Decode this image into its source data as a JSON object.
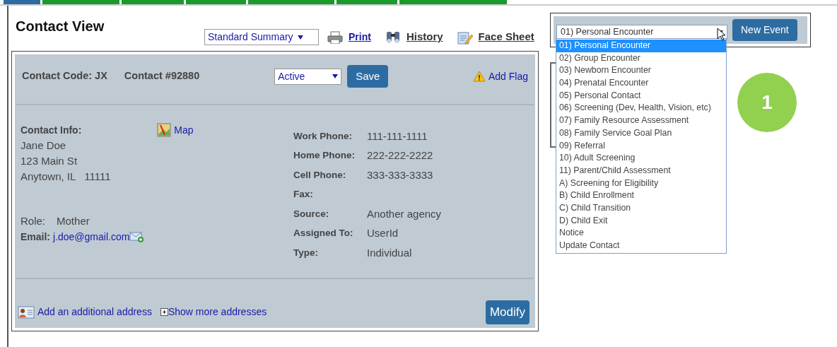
{
  "nav_tabs": [
    {
      "selected": true
    },
    {
      "selected": false
    },
    {
      "selected": false
    },
    {
      "selected": false
    },
    {
      "selected": false
    },
    {
      "selected": false
    },
    {
      "selected": false
    }
  ],
  "page_title": "Contact View",
  "summary_select": {
    "value": "Standard Summary"
  },
  "actions": [
    {
      "label": "Print",
      "kind": "print"
    },
    {
      "label": "History",
      "kind": "history"
    },
    {
      "label": "Face Sheet",
      "kind": "facesheet"
    }
  ],
  "contact": {
    "code_label": "Contact Code: JX",
    "number_label": "Contact #92880",
    "status_select": {
      "value": "Active"
    },
    "save_button": "Save",
    "add_flag": "Add Flag",
    "info_label": "Contact Info:",
    "map_link": "Map",
    "address_lines": [
      "Jane Doe",
      "123 Main St",
      "Anytown, IL   11111"
    ],
    "role_label": "Role:",
    "role": "Mother",
    "email_label": "Email:",
    "email": "j.doe@gmail.com",
    "fields": [
      {
        "label": "Work Phone:",
        "value": "111-111-1111"
      },
      {
        "label": "Home Phone:",
        "value": "222-222-2222"
      },
      {
        "label": "Cell Phone:",
        "value": "333-333-3333"
      },
      {
        "label": "Fax:"
      },
      {
        "label": "Source:",
        "value": "Another agency"
      },
      {
        "label": "Assigned To:",
        "value": "UserId"
      },
      {
        "label": "Type:",
        "value": "Individual"
      }
    ],
    "add_address": "Add an additional address",
    "show_more": "Show more addresses",
    "modify_button": "Modify"
  },
  "event": {
    "select_value": "01) Personal Encounter",
    "new_event_button": "New Event",
    "options": [
      {
        "label": "01) Personal Encounter",
        "selected": true
      },
      {
        "label": "02) Group Encounter",
        "selected": false
      },
      {
        "label": "03) Newborn Encounter",
        "selected": false
      },
      {
        "label": "04) Prenatal Encounter",
        "selected": false
      },
      {
        "label": "05) Personal Contact",
        "selected": false
      },
      {
        "label": "06) Screening (Dev, Health, Vision, etc)",
        "selected": false
      },
      {
        "label": "07) Family Resource Assessment",
        "selected": false
      },
      {
        "label": "08) Family Service Goal Plan",
        "selected": false
      },
      {
        "label": "09) Referral",
        "selected": false
      },
      {
        "label": "10) Adult Screening",
        "selected": false
      },
      {
        "label": "11) Parent/Child Assessment",
        "selected": false
      },
      {
        "label": "A) Screening for Eligibility",
        "selected": false
      },
      {
        "label": "B) Child Enrollment",
        "selected": false
      },
      {
        "label": "C) Child Transition",
        "selected": false
      },
      {
        "label": "D) Child Exit",
        "selected": false
      },
      {
        "label": "Notice",
        "selected": false
      },
      {
        "label": "Update Contact",
        "selected": false
      }
    ]
  },
  "step_badge": "1"
}
